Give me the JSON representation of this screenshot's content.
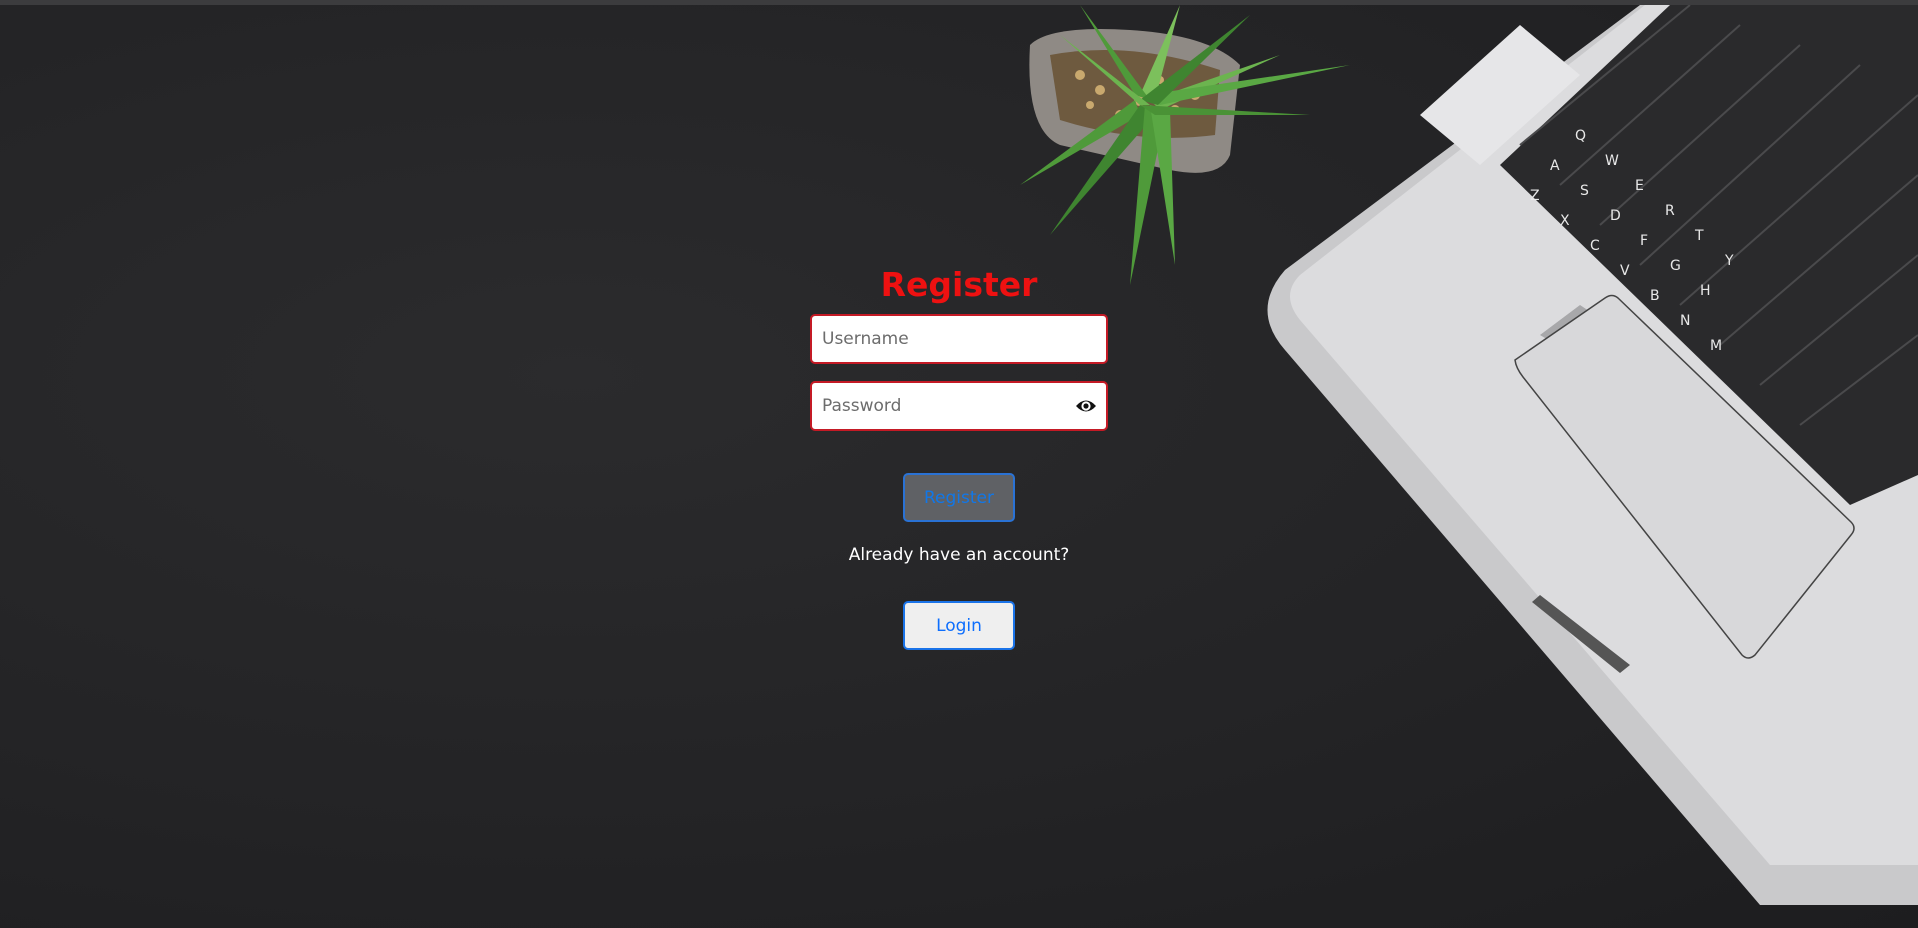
{
  "form": {
    "title": "Register",
    "username_placeholder": "Username",
    "password_placeholder": "Password",
    "register_button": "Register",
    "account_prompt": "Already have an account?",
    "login_button": "Login"
  },
  "icons": {
    "password_toggle": "eye-icon"
  },
  "colors": {
    "title": "#ee1111",
    "field_border": "#c41a25",
    "button_border": "#0d6efd",
    "background": "#232325"
  }
}
